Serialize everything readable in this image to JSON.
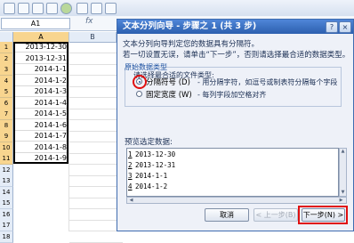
{
  "spreadsheet": {
    "name_box": "A1",
    "fx_symbol": "fx",
    "columns": [
      "A",
      "B"
    ],
    "rows": [
      "1",
      "2",
      "3",
      "4",
      "5",
      "6",
      "7",
      "8",
      "9",
      "10",
      "11",
      "12",
      "13",
      "14",
      "15",
      "16",
      "17",
      "18"
    ],
    "cells": [
      "2013-12-30",
      "2013-12-31",
      "2014-1-1",
      "2014-1-2",
      "2014-1-3",
      "2014-1-4",
      "2014-1-5",
      "2014-1-6",
      "2014-1-7",
      "2014-1-8",
      "2014-1-9"
    ]
  },
  "dialog": {
    "title": "文本分列向导 - 步骤之 1 (共 3 步)",
    "help_button": "?",
    "close_button": "×",
    "intro_line1": "文本分列向导判定您的数据具有分隔符。",
    "intro_line2": "若一切设置无误，请单击“下一步”，否则请选择最合适的数据类型。",
    "group_title": "原始数据类型",
    "hint": "请选择最合适的文件类型:",
    "options": [
      {
        "label": "分隔符号 (D)",
        "desc": "- 用分隔字符，如逗号或制表符分隔每个字段",
        "selected": true
      },
      {
        "label": "固定宽度 (W)",
        "desc": "- 每列字段加空格对齐",
        "selected": false
      }
    ],
    "preview_label": "预览选定数据:",
    "preview_rows": [
      {
        "num": "1",
        "text": "2013-12-30"
      },
      {
        "num": "2",
        "text": "2013-12-31"
      },
      {
        "num": "3",
        "text": "2014-1-1"
      },
      {
        "num": "4",
        "text": "2014-1-2"
      }
    ],
    "buttons": {
      "cancel": "取消",
      "back": "< 上一步(B)",
      "next": "下一步(N) >"
    },
    "highlight_color": "#e01010"
  }
}
